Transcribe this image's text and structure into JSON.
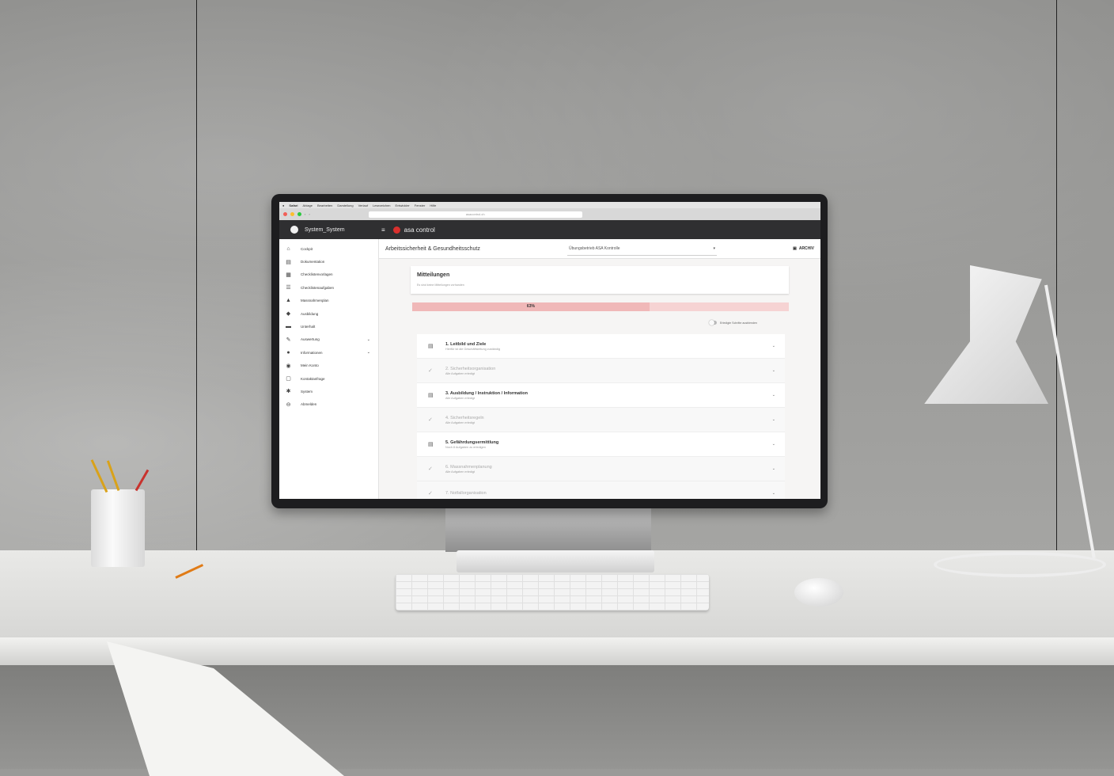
{
  "app": {
    "user_name": "System_System",
    "brand_name": "asa control",
    "url": "asacontrol.ch"
  },
  "mac_menu": [
    "Safari",
    "Ablage",
    "Bearbeiten",
    "Darstellung",
    "Verlauf",
    "Lesezeichen",
    "Entwickler",
    "Fenster",
    "Hilfe"
  ],
  "sidebar": {
    "items": [
      {
        "label": "Cockpit",
        "icon": "home-icon"
      },
      {
        "label": "Dokumentation",
        "icon": "document-icon"
      },
      {
        "label": "Checklistenvorlagen",
        "icon": "clipboard-icon"
      },
      {
        "label": "Checklistenaufgaben",
        "icon": "list-icon"
      },
      {
        "label": "Massnahmenplan",
        "icon": "warning-icon"
      },
      {
        "label": "Ausbildung",
        "icon": "graduation-cap-icon"
      },
      {
        "label": "Unterhalt",
        "icon": "truck-icon"
      },
      {
        "label": "Auswertung",
        "icon": "chart-icon",
        "expandable": true
      },
      {
        "label": "Informationen",
        "icon": "info-icon",
        "expandable": true
      },
      {
        "label": "Mein Konto",
        "icon": "user-icon"
      },
      {
        "label": "Kontaktanfrage",
        "icon": "chat-icon"
      },
      {
        "label": "System",
        "icon": "gear-icon"
      },
      {
        "label": "Abmelden",
        "icon": "logout-icon"
      }
    ]
  },
  "header": {
    "title": "Arbeitssicherheit & Gesundheitsschutz",
    "select_value": "Übungsbetrieb ASA Kontrolle",
    "archive_label": "ARCHIV"
  },
  "notice": {
    "title": "Mitteilungen",
    "text": "Es sind keine Mitteilungen vorhanden"
  },
  "progress": {
    "percent": 63,
    "label": "63%"
  },
  "toggle_label": "Erledigte Schritte ausblenden",
  "steps": [
    {
      "title": "1. Leitbild und Ziele",
      "subtitle": "Hierfür ist die Geschäftsleitung zuständig",
      "done": false,
      "icon": "task-icon"
    },
    {
      "title": "2. Sicherheitsorganisation",
      "subtitle": "Alle Aufgaben erledigt",
      "done": true,
      "icon": "check-icon"
    },
    {
      "title": "3. Ausbildung / Instruktion / Information",
      "subtitle": "Alle Aufgaben erledigt",
      "done": false,
      "icon": "task-icon"
    },
    {
      "title": "4. Sicherheitsregeln",
      "subtitle": "Alle Aufgaben erledigt",
      "done": true,
      "icon": "check-icon"
    },
    {
      "title": "5. Gefährdungsermittlung",
      "subtitle": "Noch 8 Aufgaben zu erledigen",
      "done": false,
      "icon": "task-icon"
    },
    {
      "title": "6. Massnahmenplanung",
      "subtitle": "Alle Aufgaben erledigt",
      "done": true,
      "icon": "check-icon"
    },
    {
      "title": "7. Notfallorganisation",
      "subtitle": "",
      "done": true,
      "icon": "check-icon"
    }
  ]
}
